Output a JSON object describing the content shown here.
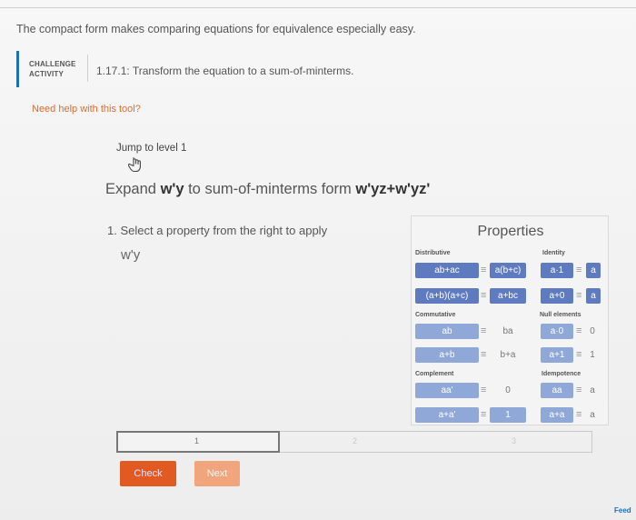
{
  "intro": "The compact form makes comparing equations for equivalence especially easy.",
  "challenge": {
    "tag_line1": "CHALLENGE",
    "tag_line2": "ACTIVITY",
    "title": "1.17.1: Transform the equation to a sum-of-minterms."
  },
  "help_link": "Need help with this tool?",
  "jump": "Jump to level 1",
  "expand": {
    "prefix": "Expand",
    "term": "w'y",
    "middle": "to sum-of-minterms form",
    "target": "w'yz+w'yz'"
  },
  "step": "1. Select a property from the right to apply",
  "expression": "w'y",
  "properties": {
    "title": "Properties",
    "sections": {
      "distributive": "Distributive",
      "commutative": "Commutative",
      "complement": "Complement",
      "identity": "Identity",
      "null_elements": "Null elements",
      "idempotence": "Idempotence"
    },
    "distributive": [
      {
        "left": "ab+ac",
        "right": "a(b+c)"
      },
      {
        "left": "(a+b)(a+c)",
        "right": "a+bc"
      }
    ],
    "commutative": [
      {
        "left": "ab",
        "right": "ba"
      },
      {
        "left": "a+b",
        "right": "b+a"
      }
    ],
    "complement": [
      {
        "left": "aa'",
        "right": "0"
      },
      {
        "left": "a+a'",
        "right": "1"
      }
    ],
    "identity": [
      {
        "left": "a·1",
        "right": "a"
      },
      {
        "left": "a+0",
        "right": "a"
      }
    ],
    "null_elements": [
      {
        "left": "a·0",
        "right": "0"
      },
      {
        "left": "a+1",
        "right": "1"
      }
    ],
    "idempotence": [
      {
        "left": "aa",
        "right": "a"
      },
      {
        "left": "a+a",
        "right": "a"
      }
    ],
    "eq_symbol": "≡"
  },
  "levels": [
    "1",
    "2",
    "3"
  ],
  "buttons": {
    "check": "Check",
    "next": "Next"
  },
  "feedback": "Feed"
}
